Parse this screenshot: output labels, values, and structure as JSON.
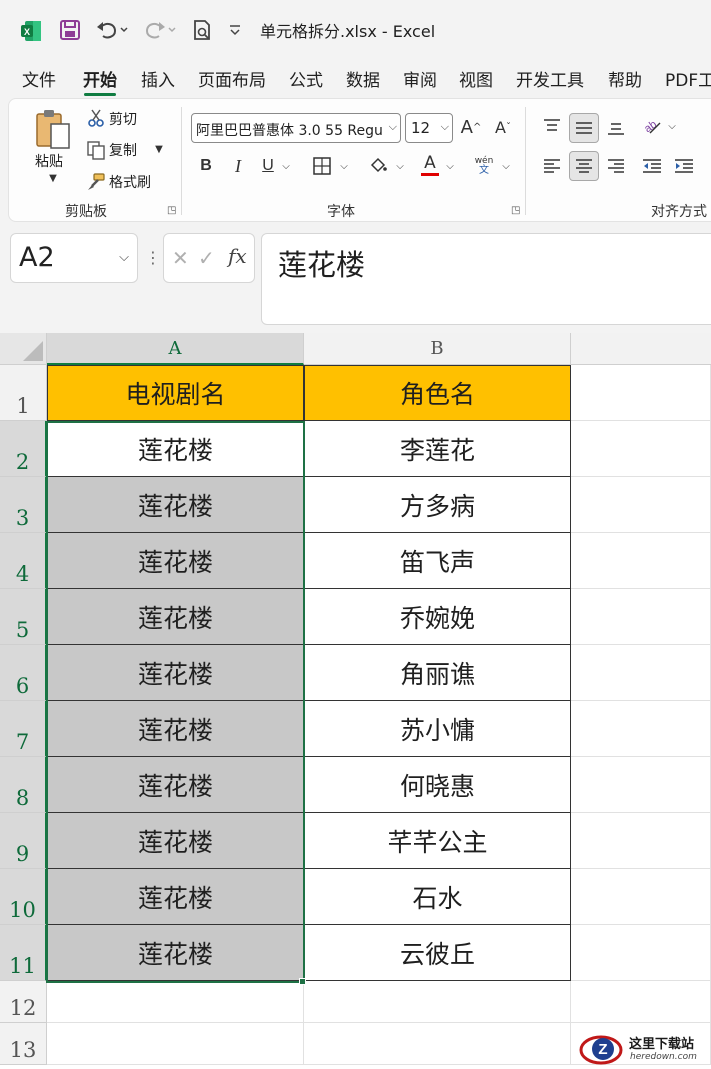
{
  "window": {
    "title": "单元格拆分.xlsx  -  Excel",
    "app_color": "#107c41"
  },
  "tabs": [
    {
      "label": "文件"
    },
    {
      "label": "开始",
      "active": true
    },
    {
      "label": "插入"
    },
    {
      "label": "页面布局"
    },
    {
      "label": "公式"
    },
    {
      "label": "数据"
    },
    {
      "label": "审阅"
    },
    {
      "label": "视图"
    },
    {
      "label": "开发工具"
    },
    {
      "label": "帮助"
    },
    {
      "label": "PDF工"
    }
  ],
  "ribbon": {
    "clipboard": {
      "paste": "粘贴",
      "cut": "剪切",
      "copy": "复制",
      "format_painter": "格式刷",
      "group_label": "剪贴板"
    },
    "font": {
      "font_name": "阿里巴巴普惠体 3.0 55 Regu",
      "font_size": "12",
      "bold": "B",
      "italic": "I",
      "underline": "U",
      "font_color_letter": "A",
      "phonetic_top": "wén",
      "phonetic_bottom": "文",
      "grow": "A",
      "shrink": "A",
      "group_label": "字体",
      "font_color_bar": "#e00000"
    },
    "alignment": {
      "group_label": "对齐方式"
    }
  },
  "formula_bar": {
    "name_box": "A2",
    "fx": "fx",
    "content": "莲花楼"
  },
  "sheet": {
    "columns": [
      "A",
      "B"
    ],
    "rows": [
      "1",
      "2",
      "3",
      "4",
      "5",
      "6",
      "7",
      "8",
      "9",
      "10",
      "11",
      "12",
      "13"
    ],
    "header": [
      "电视剧名",
      "角色名"
    ],
    "data": [
      [
        "莲花楼",
        "李莲花"
      ],
      [
        "莲花楼",
        "方多病"
      ],
      [
        "莲花楼",
        "笛飞声"
      ],
      [
        "莲花楼",
        "乔婉娩"
      ],
      [
        "莲花楼",
        "角丽谯"
      ],
      [
        "莲花楼",
        "苏小慵"
      ],
      [
        "莲花楼",
        "何晓惠"
      ],
      [
        "莲花楼",
        "芊芊公主"
      ],
      [
        "莲花楼",
        "石水"
      ],
      [
        "莲花楼",
        "云彼丘"
      ]
    ],
    "header_fill": "#ffc000",
    "selection_fill": "#c8c8c8"
  },
  "watermark": {
    "text": "这里下载站",
    "sub": "heredown.com"
  }
}
